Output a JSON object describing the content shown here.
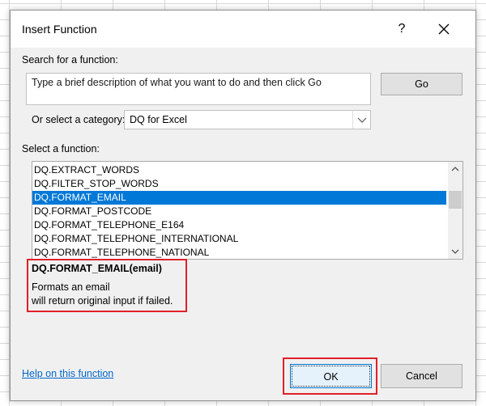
{
  "window": {
    "title": "Insert Function",
    "help_glyph": "?",
    "close_icon": "close-icon"
  },
  "search": {
    "label": "Search for a function:",
    "value": "Type a brief description of what you want to do and then click Go",
    "go_label": "Go"
  },
  "category": {
    "label": "Or select a category:",
    "selected": "DQ for Excel"
  },
  "functions": {
    "label": "Select a function:",
    "items": [
      "DQ.EXTRACT_WORDS",
      "DQ.FILTER_STOP_WORDS",
      "DQ.FORMAT_EMAIL",
      "DQ.FORMAT_POSTCODE",
      "DQ.FORMAT_TELEPHONE_E164",
      "DQ.FORMAT_TELEPHONE_INTERNATIONAL",
      "DQ.FORMAT_TELEPHONE_NATIONAL"
    ],
    "selected_index": 2
  },
  "details": {
    "signature": "DQ.FORMAT_EMAIL(email)",
    "description_line1": "Formats an email",
    "description_line2": "will return original input if failed."
  },
  "footer": {
    "help_link": "Help on this function",
    "ok_label": "OK",
    "cancel_label": "Cancel"
  },
  "colors": {
    "selection": "#0078d7",
    "highlight_border": "#e0202a",
    "link": "#0066cc"
  }
}
